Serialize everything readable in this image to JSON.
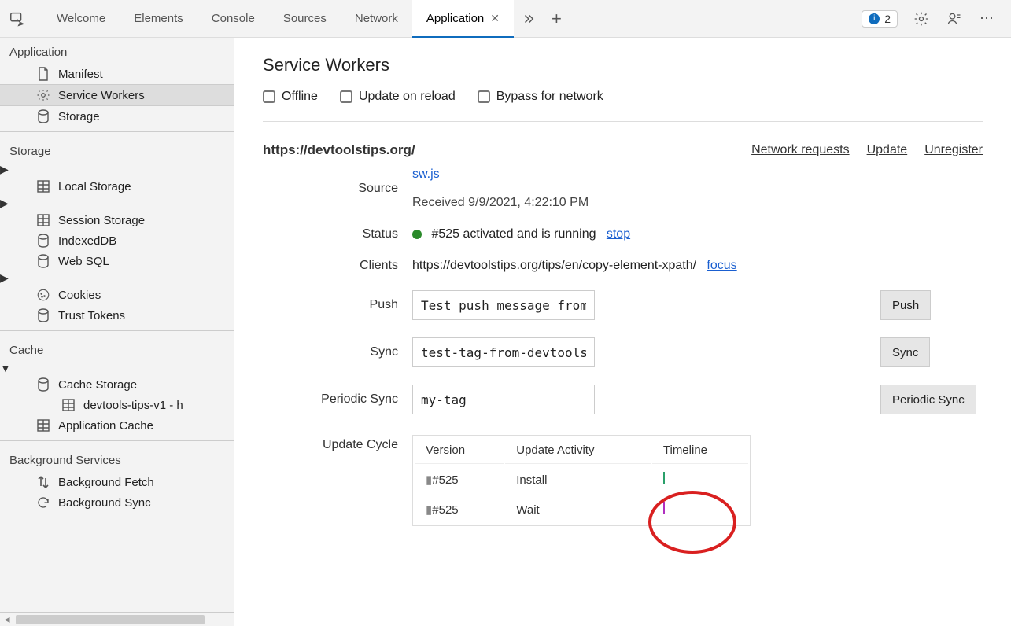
{
  "topbar": {
    "tabs": [
      "Welcome",
      "Elements",
      "Console",
      "Sources",
      "Network",
      "Application"
    ],
    "active_tab": "Application",
    "issue_count": "2"
  },
  "sidebar": {
    "section_application": "Application",
    "app_items": {
      "manifest": "Manifest",
      "service_workers": "Service Workers",
      "storage": "Storage"
    },
    "section_storage": "Storage",
    "storage_items": {
      "local_storage": "Local Storage",
      "session_storage": "Session Storage",
      "indexeddb": "IndexedDB",
      "websql": "Web SQL",
      "cookies": "Cookies",
      "trust_tokens": "Trust Tokens"
    },
    "section_cache": "Cache",
    "cache_items": {
      "cache_storage": "Cache Storage",
      "cache_entry": "devtools-tips-v1 - h",
      "app_cache": "Application Cache"
    },
    "section_bgs": "Background Services",
    "bgs_items": {
      "bg_fetch": "Background Fetch",
      "bg_sync": "Background Sync"
    }
  },
  "sw": {
    "title": "Service Workers",
    "checks": {
      "offline": "Offline",
      "update_reload": "Update on reload",
      "bypass": "Bypass for network"
    },
    "origin": "https://devtoolstips.org/",
    "actions": {
      "network": "Network requests",
      "update": "Update",
      "unregister": "Unregister"
    },
    "labels": {
      "source": "Source",
      "status": "Status",
      "clients": "Clients",
      "push": "Push",
      "sync": "Sync",
      "periodic": "Periodic Sync",
      "update_cycle": "Update Cycle"
    },
    "source_file": "sw.js",
    "received": "Received 9/9/2021, 4:22:10 PM",
    "status_text": "#525 activated and is running",
    "stop": "stop",
    "client_url": "https://devtoolstips.org/tips/en/copy-element-xpath/",
    "focus": "focus",
    "push_value": "Test push message from DevTools.",
    "push_btn": "Push",
    "sync_value": "test-tag-from-devtools",
    "sync_btn": "Sync",
    "periodic_value": "my-tag",
    "periodic_btn": "Periodic Sync",
    "table": {
      "h_version": "Version",
      "h_activity": "Update Activity",
      "h_timeline": "Timeline",
      "rows": [
        {
          "version": "#525",
          "activity": "Install",
          "color": "#2aa06a"
        },
        {
          "version": "#525",
          "activity": "Wait",
          "color": "#b030c0"
        }
      ]
    }
  }
}
